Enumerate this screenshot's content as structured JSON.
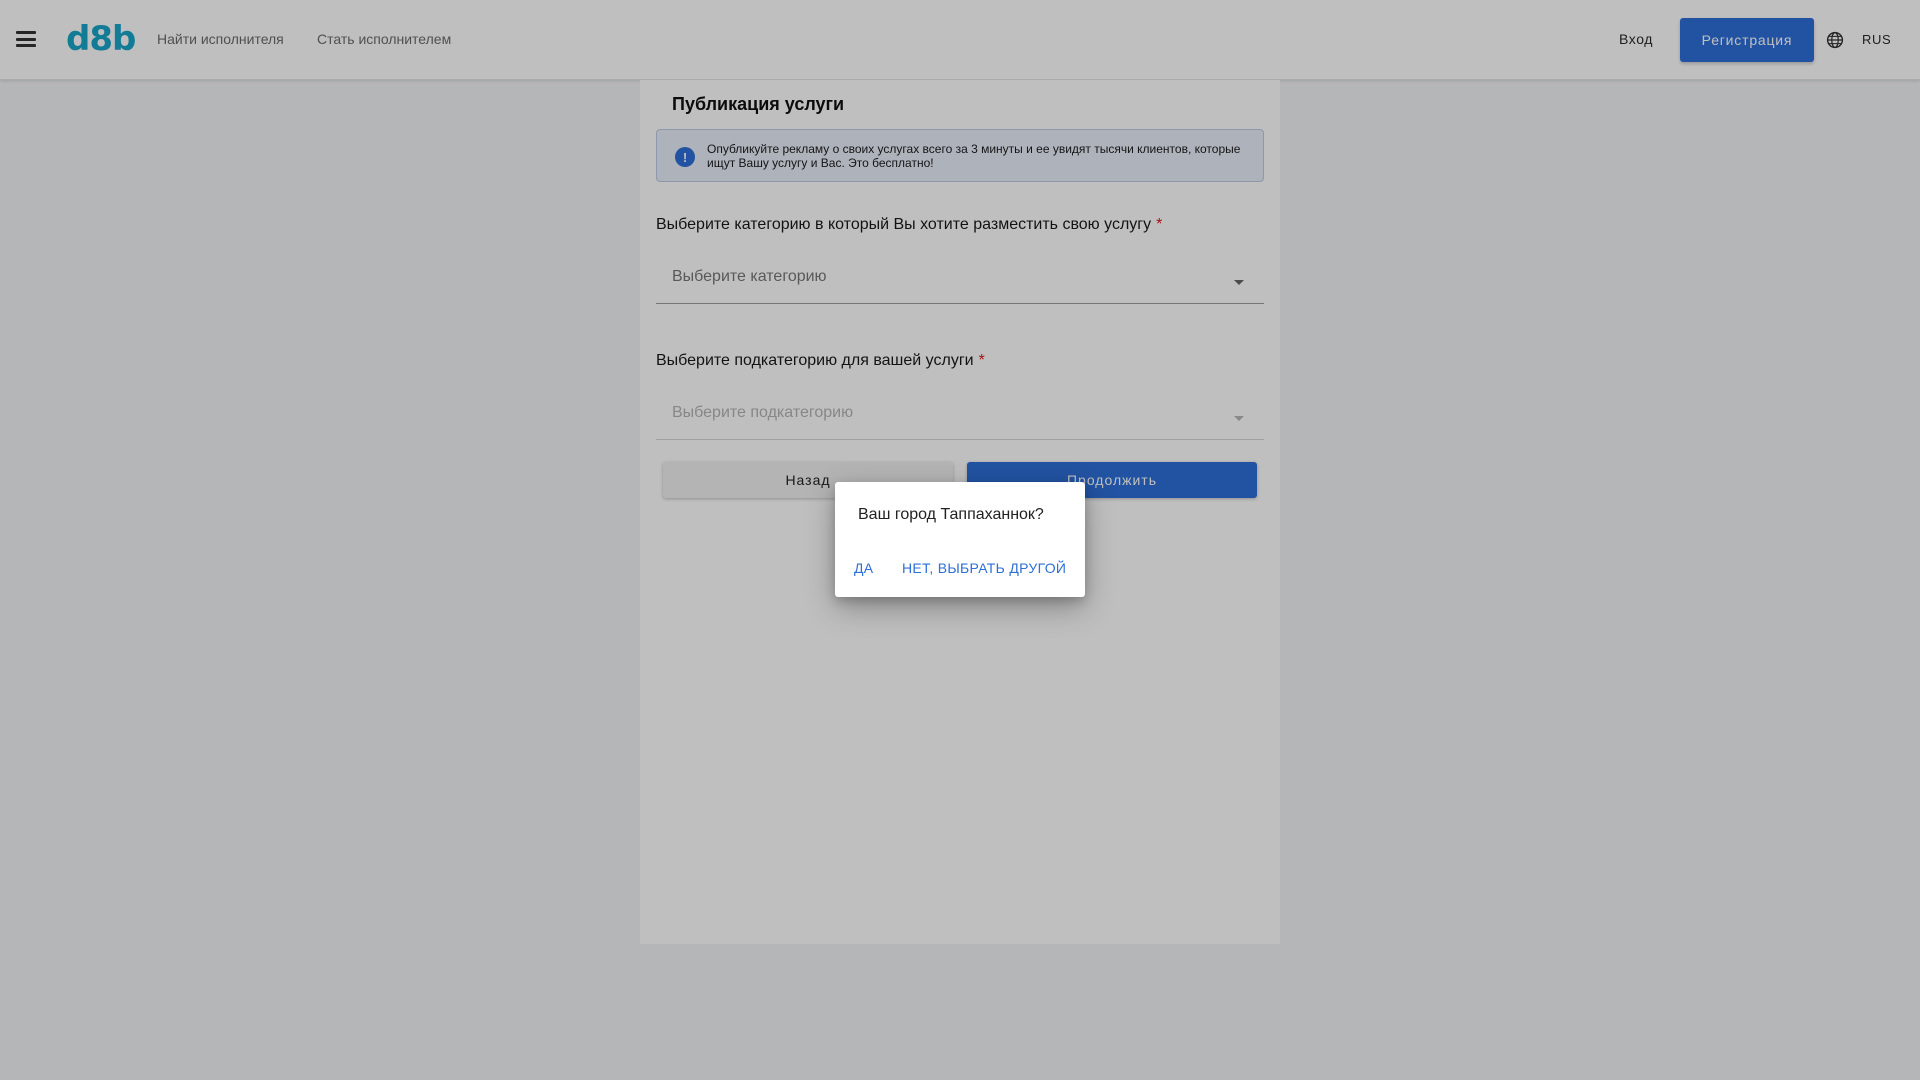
{
  "header": {
    "logo": "d8b",
    "nav": {
      "find_performer": "Найти исполнителя",
      "become_performer": "Стать исполнителем"
    },
    "login": "Вход",
    "register": "Регистрация",
    "language": "RUS",
    "icons": {
      "menu": "hamburger-menu-icon",
      "language": "globe-icon"
    }
  },
  "card": {
    "title": "Публикация услуги",
    "info_text": "Опубликуйте рекламу о своих услугах всего за 3 минуты и ее увидят тысячи клиентов, которые ищут Вашу услугу и Вас. Это бесплатно!",
    "info_icon_glyph": "!",
    "category": {
      "label": "Выберите категорию в который Вы хотите разместить свою услугу",
      "required_mark": "*",
      "placeholder": "Выберите категорию"
    },
    "subcategory": {
      "label": "Выберите подкатегорию для вашей услуги",
      "required_mark": "*",
      "placeholder": "Выберите подкатегорию"
    },
    "back_button": "Назад",
    "continue_button": "Продолжить"
  },
  "dialog": {
    "question": "Ваш город Таппаханнок?",
    "yes": "ДА",
    "no": "НЕТ, ВЫБРАТЬ ДРУГОЙ"
  },
  "colors": {
    "brand": "#18a5c9",
    "primary": "#2e6fd8",
    "required": "#e01818",
    "info_bg": "#e8eef9"
  }
}
